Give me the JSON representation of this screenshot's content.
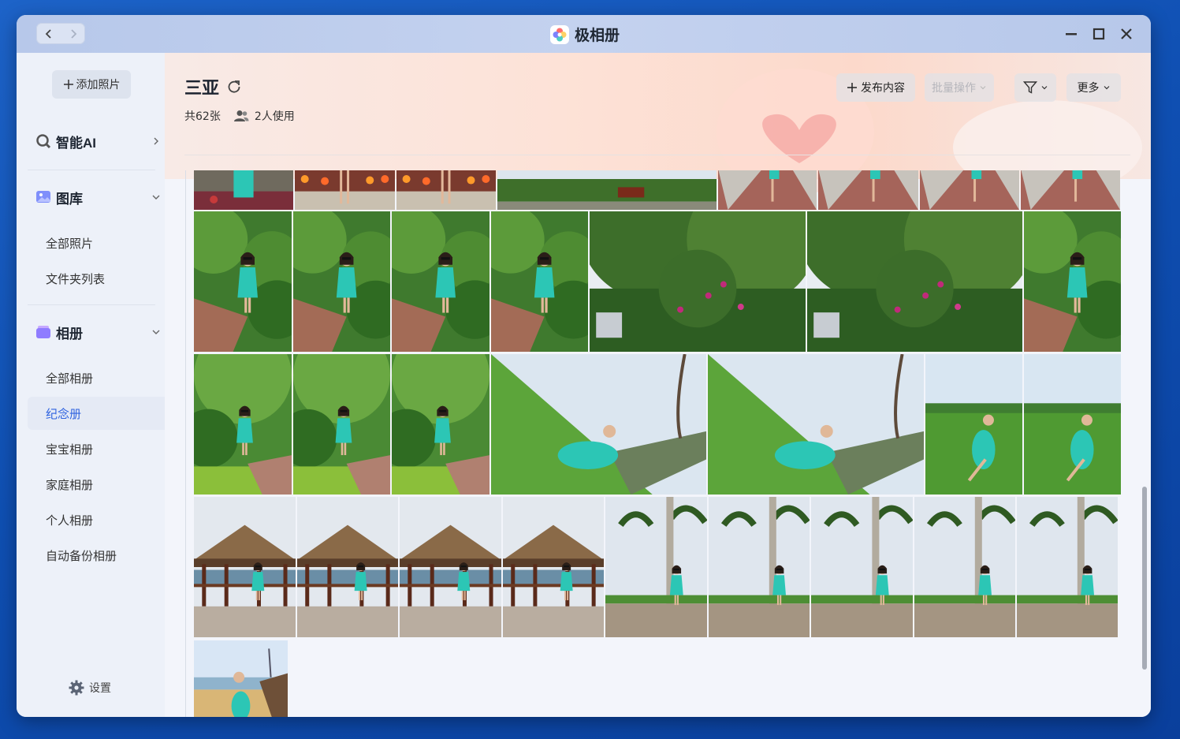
{
  "app": {
    "title": "极相册"
  },
  "sidebar": {
    "add_button": "添加照片",
    "sections": [
      {
        "label": "智能AI",
        "icon": "smart-ai-icon"
      },
      {
        "label": "图库",
        "icon": "gallery-icon"
      },
      {
        "label": "相册",
        "icon": "album-icon"
      }
    ],
    "gallery_items": [
      "全部照片",
      "文件夹列表"
    ],
    "album_items": [
      "全部相册",
      "纪念册",
      "宝宝相册",
      "家庭相册",
      "个人相册",
      "自动备份相册"
    ],
    "active_item": "纪念册",
    "settings_label": "设置"
  },
  "header": {
    "album_title": "三亚",
    "count": "共62张",
    "users": "2人使用",
    "publish_label": "发布内容",
    "batch_label": "批量操作",
    "more_label": "更多"
  },
  "colors": {
    "accent": "#2f63e0",
    "dress": "#2cc6b5"
  },
  "photos": [
    {
      "scene": "forest-dress",
      "row": 0
    },
    {
      "scene": "flowers-legs",
      "row": 0
    },
    {
      "scene": "flowers-legs",
      "row": 0
    },
    {
      "scene": "resort-landscape",
      "row": 0
    },
    {
      "scene": "pavement-legs",
      "row": 0
    },
    {
      "scene": "pavement-legs",
      "row": 0
    },
    {
      "scene": "pavement-legs",
      "row": 0
    },
    {
      "scene": "pavement-legs",
      "row": 0
    },
    {
      "scene": "garden-portrait",
      "row": 1
    },
    {
      "scene": "garden-portrait",
      "row": 1
    },
    {
      "scene": "garden-portrait",
      "row": 1
    },
    {
      "scene": "garden-portrait",
      "row": 1
    },
    {
      "scene": "tree-flowers",
      "row": 1
    },
    {
      "scene": "tree-flowers",
      "row": 1
    },
    {
      "scene": "garden-portrait",
      "row": 1
    },
    {
      "scene": "bush-portrait",
      "row": 2
    },
    {
      "scene": "bush-portrait",
      "row": 2
    },
    {
      "scene": "bush-portrait",
      "row": 2
    },
    {
      "scene": "lawn-tilted",
      "row": 2
    },
    {
      "scene": "lawn-tilted",
      "row": 2
    },
    {
      "scene": "lawn-sitting",
      "row": 2
    },
    {
      "scene": "lawn-sitting",
      "row": 2
    },
    {
      "scene": "gazebo",
      "row": 3
    },
    {
      "scene": "gazebo",
      "row": 3
    },
    {
      "scene": "gazebo",
      "row": 3
    },
    {
      "scene": "gazebo",
      "row": 3
    },
    {
      "scene": "palms",
      "row": 3
    },
    {
      "scene": "palms",
      "row": 3
    },
    {
      "scene": "palms",
      "row": 3
    },
    {
      "scene": "palms",
      "row": 3
    },
    {
      "scene": "palms",
      "row": 3
    },
    {
      "scene": "beach",
      "row": 4
    }
  ]
}
